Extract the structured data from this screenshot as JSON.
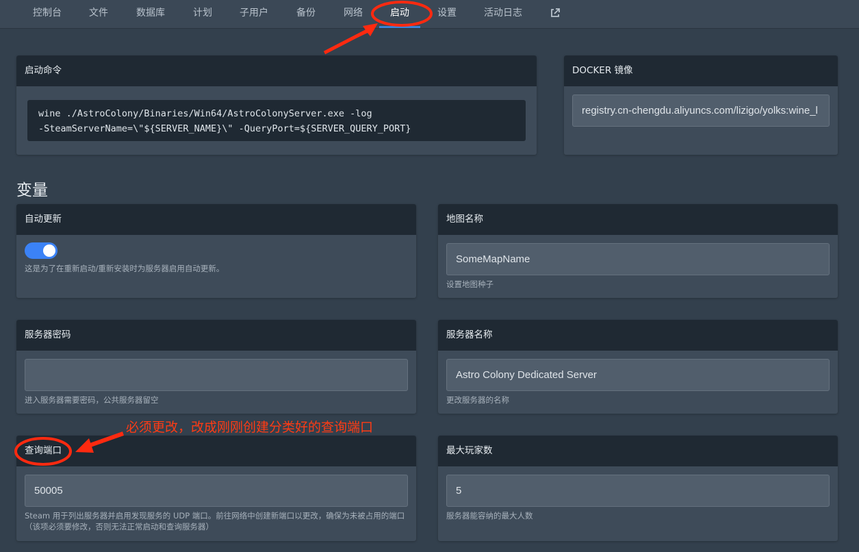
{
  "nav": {
    "items": [
      "控制台",
      "文件",
      "数据库",
      "计划",
      "子用户",
      "备份",
      "网络",
      "启动",
      "设置",
      "活动日志"
    ],
    "active": "启动",
    "external_icon": "external-link-icon"
  },
  "startup": {
    "title": "启动命令",
    "command_line1": "wine ./AstroColony/Binaries/Win64/AstroColonyServer.exe -log",
    "command_line2": "-SteamServerName=\\\"${SERVER_NAME}\\\" -QueryPort=${SERVER_QUERY_PORT}"
  },
  "docker": {
    "title": "DOCKER 镜像",
    "value": "registry.cn-chengdu.aliyuncs.com/lizigo/yolks:wine_l"
  },
  "variables": {
    "title": "变量",
    "auto_update": {
      "title": "自动更新",
      "enabled": true,
      "help": "这是为了在重新启动/重新安装时为服务器启用自动更新。"
    },
    "map_name": {
      "title": "地图名称",
      "value": "SomeMapName",
      "help": "设置地图种子"
    },
    "server_password": {
      "title": "服务器密码",
      "value": "",
      "help": "进入服务器需要密码，公共服务器留空"
    },
    "server_name": {
      "title": "服务器名称",
      "value": "Astro Colony Dedicated Server",
      "help": "更改服务器的名称"
    },
    "query_port": {
      "title": "查询端口",
      "value": "50005",
      "help": "Steam 用于列出服务器并启用发现服务的 UDP 端口。前往网络中创建新端口以更改，确保为未被占用的端口（该项必须要修改，否则无法正常启动和查询服务器）"
    },
    "max_players": {
      "title": "最大玩家数",
      "value": "5",
      "help": "服务器能容纳的最大人数"
    }
  },
  "annotation": {
    "text": "必须更改，改成刚刚创建分类好的查询端口",
    "color": "#ff3b14"
  }
}
